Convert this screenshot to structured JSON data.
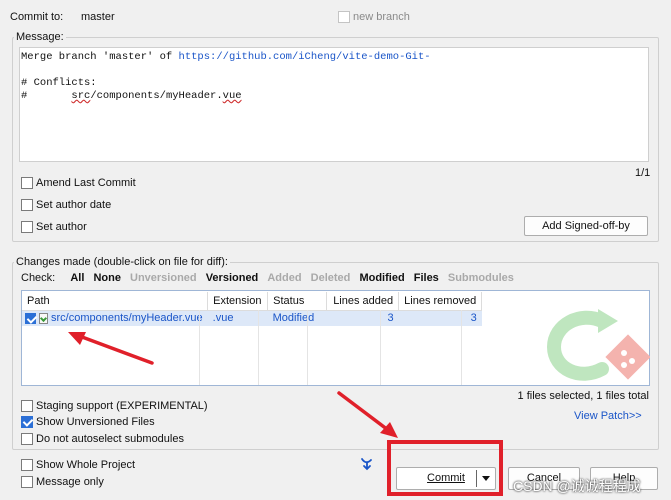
{
  "commit_to": {
    "label": "Commit to:",
    "branch": "master",
    "new_branch_label": "new branch"
  },
  "message": {
    "group_label": "Message:",
    "line1_prefix": "Merge branch 'master' of ",
    "line1_link": "https://github.com/iCheng/vite-demo-Git-",
    "line2": "",
    "line3": "# Conflicts:",
    "line4_prefix": "#       ",
    "line4_a": "src",
    "line4_b": "/components/myHeader.",
    "line4_c": "vue",
    "counter": "1/1"
  },
  "options": {
    "amend": "Amend Last Commit",
    "author_date": "Set author date",
    "author": "Set author",
    "signed_off": "Add Signed-off-by"
  },
  "changes": {
    "group_label": "Changes made (double-click on file for diff):",
    "check_label": "Check:",
    "filters": [
      {
        "label": "All",
        "enabled": true
      },
      {
        "label": "None",
        "enabled": true
      },
      {
        "label": "Unversioned",
        "enabled": false
      },
      {
        "label": "Versioned",
        "enabled": true
      },
      {
        "label": "Added",
        "enabled": false
      },
      {
        "label": "Deleted",
        "enabled": false
      },
      {
        "label": "Modified",
        "enabled": true
      },
      {
        "label": "Files",
        "enabled": true
      },
      {
        "label": "Submodules",
        "enabled": false
      }
    ],
    "columns": [
      "Path",
      "Extension",
      "Status",
      "Lines added",
      "Lines removed"
    ],
    "rows": [
      {
        "path": "src/components/myHeader.vue",
        "extension": ".vue",
        "status": "Modified",
        "added": "3",
        "removed": "3",
        "checked": true
      }
    ],
    "summary": "1 files selected, 1 files total",
    "view_patch": "View Patch>>"
  },
  "bottom_options": {
    "staging": "Staging support (EXPERIMENTAL)",
    "show_unversioned": "Show Unversioned Files",
    "no_autoselect": "Do not autoselect submodules",
    "show_whole": "Show Whole Project",
    "message_only": "Message only"
  },
  "buttons": {
    "commit": "Commit",
    "cancel": "Cancel",
    "help": "Help"
  },
  "watermark": "CSDN @诚诚程程成",
  "colors": {
    "annotation_red": "#e0202a",
    "link_blue": "#1a55c8",
    "selection": "#dde8f8"
  }
}
